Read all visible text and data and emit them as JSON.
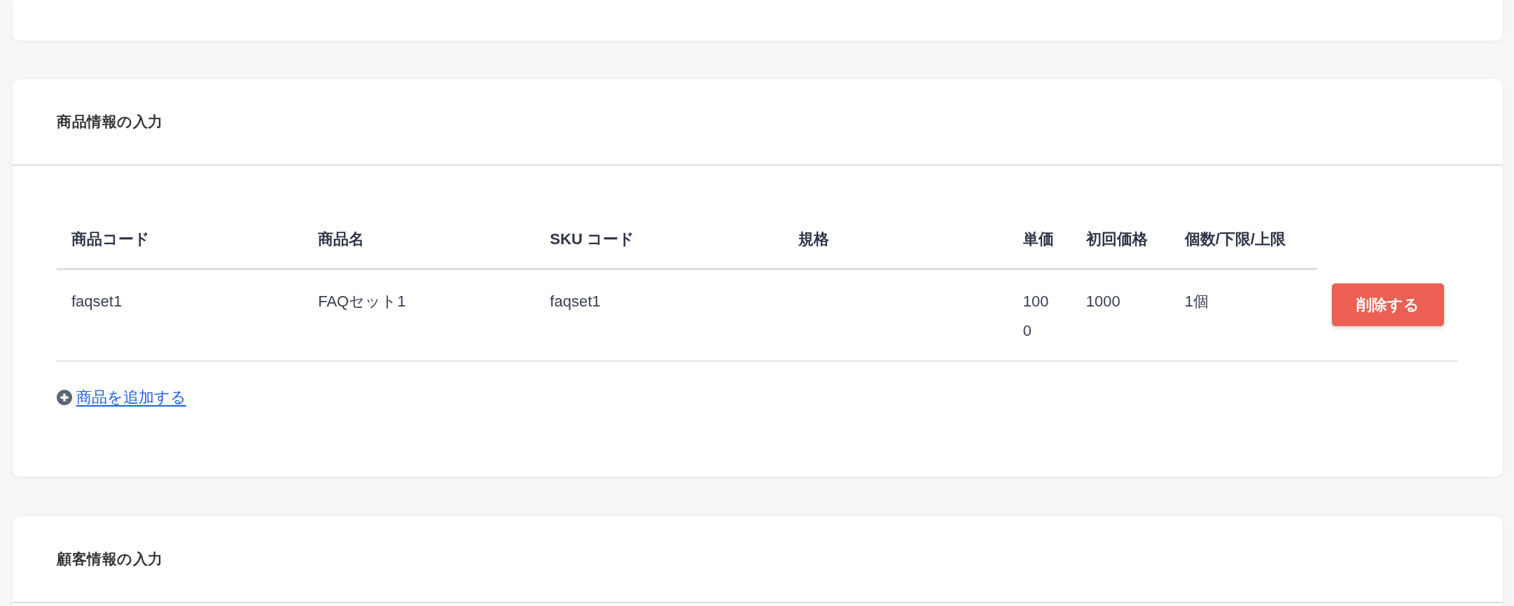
{
  "product_section": {
    "title": "商品情報の入力",
    "table": {
      "columns": [
        "商品コード",
        "商品名",
        "SKU コード",
        "規格",
        "単価",
        "初回価格",
        "個数/下限/上限"
      ],
      "rows": [
        {
          "cells": [
            "faqset1",
            "FAQセット1",
            "faqset1",
            null,
            "1000",
            "1000",
            "1個"
          ],
          "action": "削除する"
        }
      ]
    },
    "add_link": "商品を追加する"
  },
  "customer_section": {
    "title": "顧客情報の入力"
  }
}
